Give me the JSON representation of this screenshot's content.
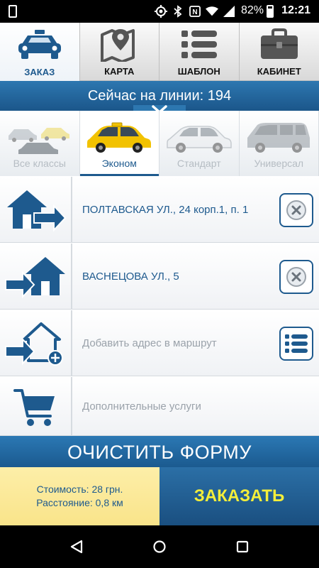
{
  "status_bar": {
    "battery_percent": "82%",
    "time": "12:21",
    "icons": [
      "location-icon",
      "bluetooth-icon",
      "nfc-icon",
      "wifi-icon",
      "signal-icon",
      "battery-icon"
    ]
  },
  "tabs": [
    {
      "label": "ЗАКАЗ",
      "icon": "taxi-icon",
      "active": true
    },
    {
      "label": "КАРТА",
      "icon": "map-pin-icon",
      "active": false
    },
    {
      "label": "ШАБЛОН",
      "icon": "list-icon",
      "active": false
    },
    {
      "label": "КАБИНЕТ",
      "icon": "briefcase-icon",
      "active": false
    }
  ],
  "online": {
    "text": "Сейчас на линии: 194"
  },
  "car_classes": [
    {
      "label": "Все классы",
      "active": false
    },
    {
      "label": "Эконом",
      "active": true
    },
    {
      "label": "Стандарт",
      "active": false
    },
    {
      "label": "Универсал",
      "active": false
    }
  ],
  "route": {
    "from": "ПОЛТАВСКАЯ УЛ., 24 корп.1, п. 1",
    "to": "ВАСНЕЦОВА УЛ., 5",
    "add_placeholder": "Добавить адрес в маршрут",
    "extras_placeholder": "Дополнительные услуги"
  },
  "actions": {
    "clear_form": "ОЧИСТИТЬ ФОРМУ",
    "order": "ЗАКАЗАТЬ"
  },
  "summary": {
    "cost": "Стоимость: 28 грн.",
    "distance": "Расстояние: 0,8 км"
  },
  "colors": {
    "primary_blue": "#1e5a8e",
    "order_text": "#f4ee3a",
    "summary_bg": "#f9e48a",
    "taxi_yellow": "#f2c200"
  }
}
